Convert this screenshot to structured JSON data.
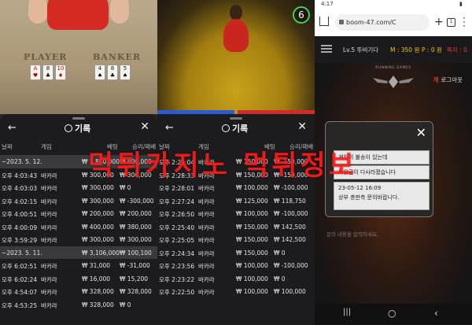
{
  "left_panel": {
    "table_player": "PLAYER",
    "table_banker": "BANKER",
    "sheet_title": "기록",
    "columns": [
      "날짜",
      "게임",
      "베팅",
      "승리/패배"
    ],
    "rows": [
      {
        "type": "date",
        "date": "~2023. 5. 12.",
        "bet": "₩ 1,800,000",
        "result": "₩ 800,000"
      },
      {
        "type": "row",
        "time": "오후 4:03:43",
        "game": "바카라",
        "bet": "₩ 300,000",
        "result": "₩ 300,000"
      },
      {
        "type": "row",
        "time": "오후 4:03:03",
        "game": "바카라",
        "bet": "₩ 300,000",
        "result": "₩ 0"
      },
      {
        "type": "row",
        "time": "오후 4:02:15",
        "game": "바카라",
        "bet": "₩ 300,000",
        "result": "₩ -300,000"
      },
      {
        "type": "row",
        "time": "오후 4:00:51",
        "game": "바카라",
        "bet": "₩ 200,000",
        "result": "₩ 200,000"
      },
      {
        "type": "row",
        "time": "오후 4:00:09",
        "game": "바카라",
        "bet": "₩ 400,000",
        "result": "₩ 380,000"
      },
      {
        "type": "row",
        "time": "오후 3:59:29",
        "game": "바카라",
        "bet": "₩ 300,000",
        "result": "₩ 300,000"
      },
      {
        "type": "date",
        "date": "~2023. 5. 11.",
        "bet": "₩ 3,106,000",
        "result": "₩ 100,100"
      },
      {
        "type": "row",
        "time": "오후 6:02:51",
        "game": "바카라",
        "bet": "₩ 31,000",
        "result": "₩ -31,000"
      },
      {
        "type": "row",
        "time": "오후 6:02:24",
        "game": "바카라",
        "bet": "₩ 16,000",
        "result": "₩ 15,200"
      },
      {
        "type": "row",
        "time": "오후 4:54:07",
        "game": "바카라",
        "bet": "₩ 328,000",
        "result": "₩ 328,000"
      },
      {
        "type": "row",
        "time": "오후 4:53:25",
        "game": "바카라",
        "bet": "₩ 328,000",
        "result": "₩ 0"
      }
    ]
  },
  "middle_panel": {
    "round_counter": "6",
    "sheet_title": "기록",
    "columns": [
      "날짜",
      "게임",
      "베팅",
      "승리/패배"
    ],
    "rows": [
      {
        "time": "오후 2:29:04",
        "game": "바카라",
        "bet": "₩ 150,000",
        "result": "₩ -150,000"
      },
      {
        "time": "오후 2:28:33",
        "game": "바카라",
        "bet": "₩ 150,000",
        "result": "₩ -150,000"
      },
      {
        "time": "오후 2:28:01",
        "game": "바카라",
        "bet": "₩ 100,000",
        "result": "₩ -100,000"
      },
      {
        "time": "오후 2:27:24",
        "game": "바카라",
        "bet": "₩ 125,000",
        "result": "₩ 118,750"
      },
      {
        "time": "오후 2:26:50",
        "game": "바카라",
        "bet": "₩ 100,000",
        "result": "₩ -100,000"
      },
      {
        "time": "오후 2:25:40",
        "game": "바카라",
        "bet": "₩ 150,000",
        "result": "₩ 142,500"
      },
      {
        "time": "오후 2:25:05",
        "game": "바카라",
        "bet": "₩ 150,000",
        "result": "₩ 142,500"
      },
      {
        "time": "오후 2:24:34",
        "game": "바카라",
        "bet": "₩ 150,000",
        "result": "₩ 0"
      },
      {
        "time": "오후 2:23:56",
        "game": "바카라",
        "bet": "₩ 100,000",
        "result": "₩ -100,000"
      },
      {
        "time": "오후 2:23:22",
        "game": "바카라",
        "bet": "₩ 100,000",
        "result": "₩ 0"
      },
      {
        "time": "오후 2:22:50",
        "game": "바카라",
        "bet": "₩ 100,000",
        "result": "₩ 100,000"
      }
    ]
  },
  "right_panel": {
    "status_time": "4:17",
    "url": "boom-47.com/C",
    "tab_count": "1",
    "level": "Lv.5 뚜비기다",
    "money_label": "M : 350 원",
    "point_label": "P : 0 원",
    "jjok_label": "쪽지 : 0",
    "login_prefix": "개",
    "login": "로그아웃",
    "logo_text": "RUNNING GAMES",
    "popup_lines": [
      "게임이 불송이 있는데",
      "보유금이 다사라졌습니다",
      "23-05-12 16:09",
      "상부 총판측 문의바랍니다."
    ],
    "input_hint": "문의 내용을 입력하세요.",
    "colors": {
      "accent_red": "#e33333",
      "yellow": "#f5c400"
    }
  },
  "watermark": "먹튀카지노 먹튀정보"
}
